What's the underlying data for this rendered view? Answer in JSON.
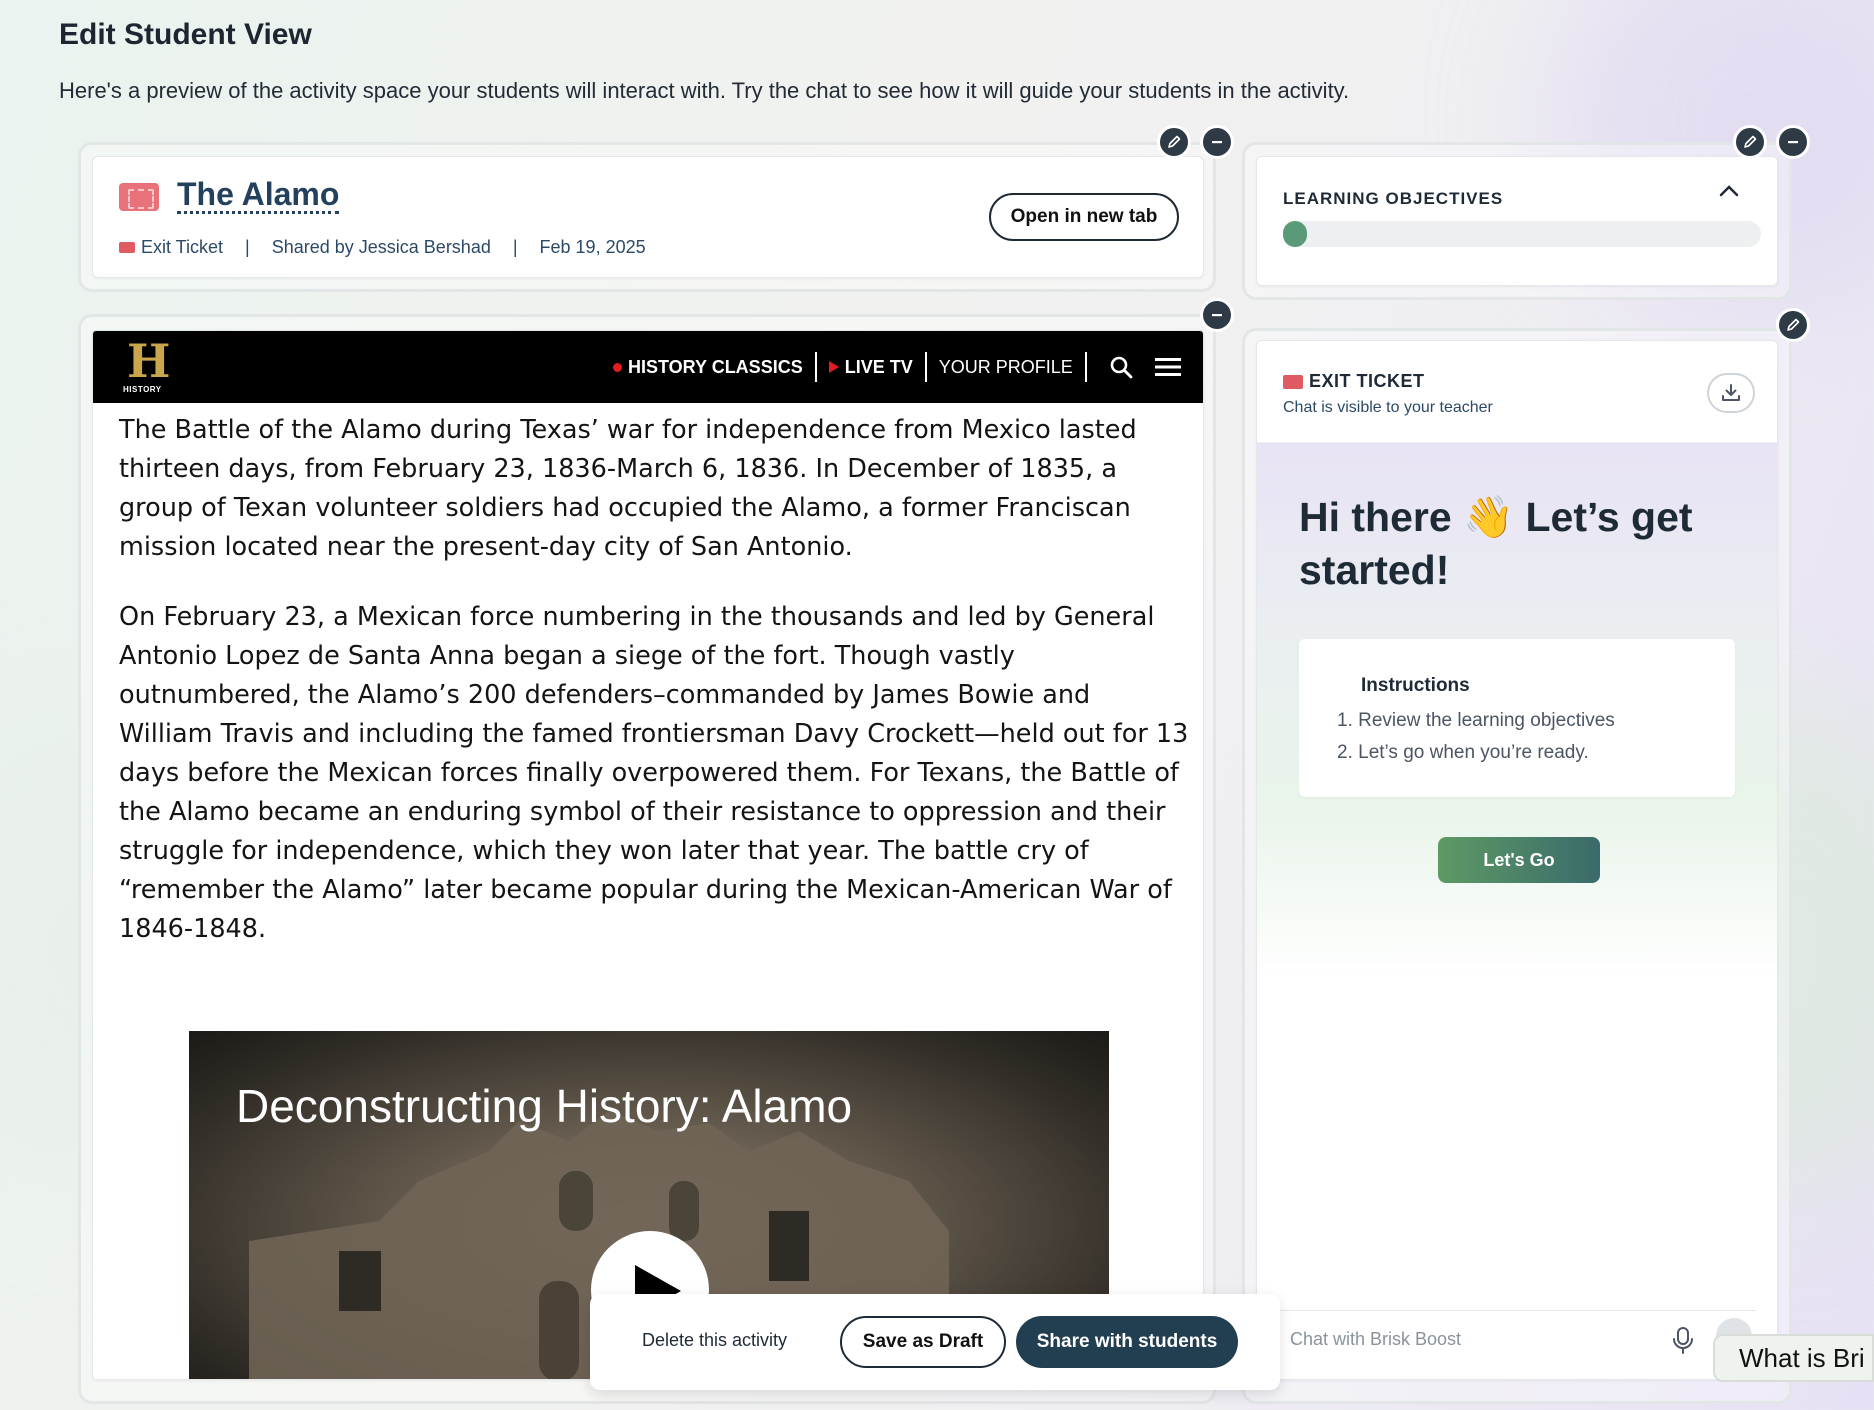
{
  "page": {
    "title": "Edit Student View",
    "description": "Here's a preview of the activity space your students will interact with. Try the chat to see how it will guide your students in the activity."
  },
  "activity": {
    "title": "The Alamo",
    "type": "Exit Ticket",
    "shared_by": "Shared by Jessica Bershad",
    "date": "Feb 19, 2025",
    "separator": "|",
    "open_new_tab": "Open in new tab"
  },
  "objectives": {
    "title": "LEARNING OBJECTIVES",
    "progress": 0.05
  },
  "history_site": {
    "logo_letter": "H",
    "logo_text": "HISTORY",
    "nav": [
      "HISTORY CLASSICS",
      "LIVE TV",
      "YOUR PROFILE"
    ],
    "paragraphs": [
      "The Battle of the Alamo during Texas’ war for independence from Mexico lasted thirteen days, from February 23, 1836-March 6, 1836. In December of 1835, a group of Texan volunteer soldiers had occupied the Alamo, a former Franciscan mission located near the present-day city of San Antonio.",
      "On February 23, a Mexican force numbering in the thousands and led by General Antonio Lopez de Santa Anna began a siege of the fort. Though vastly outnumbered, the Alamo’s 200 defenders–commanded by James Bowie and William Travis and including the famed frontiersman Davy Crockett—held out for 13 days before the Mexican forces finally overpowered them. For Texans, the Battle of the Alamo became an enduring symbol of their resistance to oppression and their struggle for independence, which they won later that year. The battle cry of “remember the Alamo” later became popular during the Mexican-American War of 1846-1848."
    ],
    "video_title": "Deconstructing History: Alamo"
  },
  "exit_ticket": {
    "title": "EXIT TICKET",
    "subtitle": "Chat is visible to your teacher",
    "greeting": "Hi there 👋 Let’s get started!",
    "instructions_title": "Instructions",
    "instructions": [
      "1. Review the learning objectives",
      "2. Let’s go when you’re ready."
    ],
    "go_button": "Let's Go",
    "chat_placeholder": "Chat with Brisk Boost"
  },
  "actions": {
    "delete": "Delete this activity",
    "save_draft": "Save as Draft",
    "share": "Share with students"
  },
  "help": {
    "text": "What is Bri"
  },
  "colors": {
    "dark_button": "#223f51",
    "accent_green": "#5a9a79",
    "ticket_red": "#e9727a",
    "history_gold": "#c9a54c"
  }
}
